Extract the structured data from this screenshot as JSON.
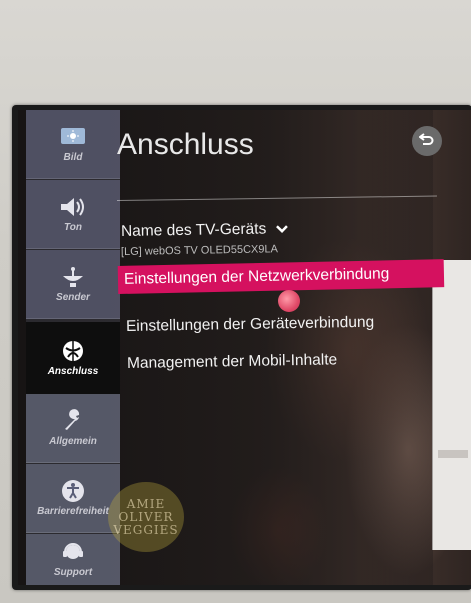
{
  "page": {
    "title": "Anschluss"
  },
  "sidebar": {
    "items": [
      {
        "label": "Bild",
        "icon": "picture-icon"
      },
      {
        "label": "Ton",
        "icon": "speaker-icon"
      },
      {
        "label": "Sender",
        "icon": "antenna-icon"
      },
      {
        "label": "Anschluss",
        "icon": "connection-icon",
        "active": true
      },
      {
        "label": "Allgemein",
        "icon": "wrench-icon"
      },
      {
        "label": "Barrierefreiheit",
        "icon": "accessibility-icon"
      },
      {
        "label": "Support",
        "icon": "headset-icon"
      }
    ]
  },
  "menu": {
    "device_name_label": "Name des TV-Geräts",
    "device_name_value": "[LG] webOS TV OLED55CX9LA",
    "items": [
      {
        "label": "Einstellungen der Netzwerkverbindung",
        "selected": true
      },
      {
        "label": "Einstellungen der Geräteverbindung"
      },
      {
        "label": "Management der Mobil-Inhalte"
      }
    ]
  },
  "watermark": {
    "line1": "AMIE",
    "line2": "OLIVER",
    "line3": "VEGGIES"
  },
  "colors": {
    "accent": "#d5115f",
    "sidebar_active": "#0e0e0e"
  }
}
